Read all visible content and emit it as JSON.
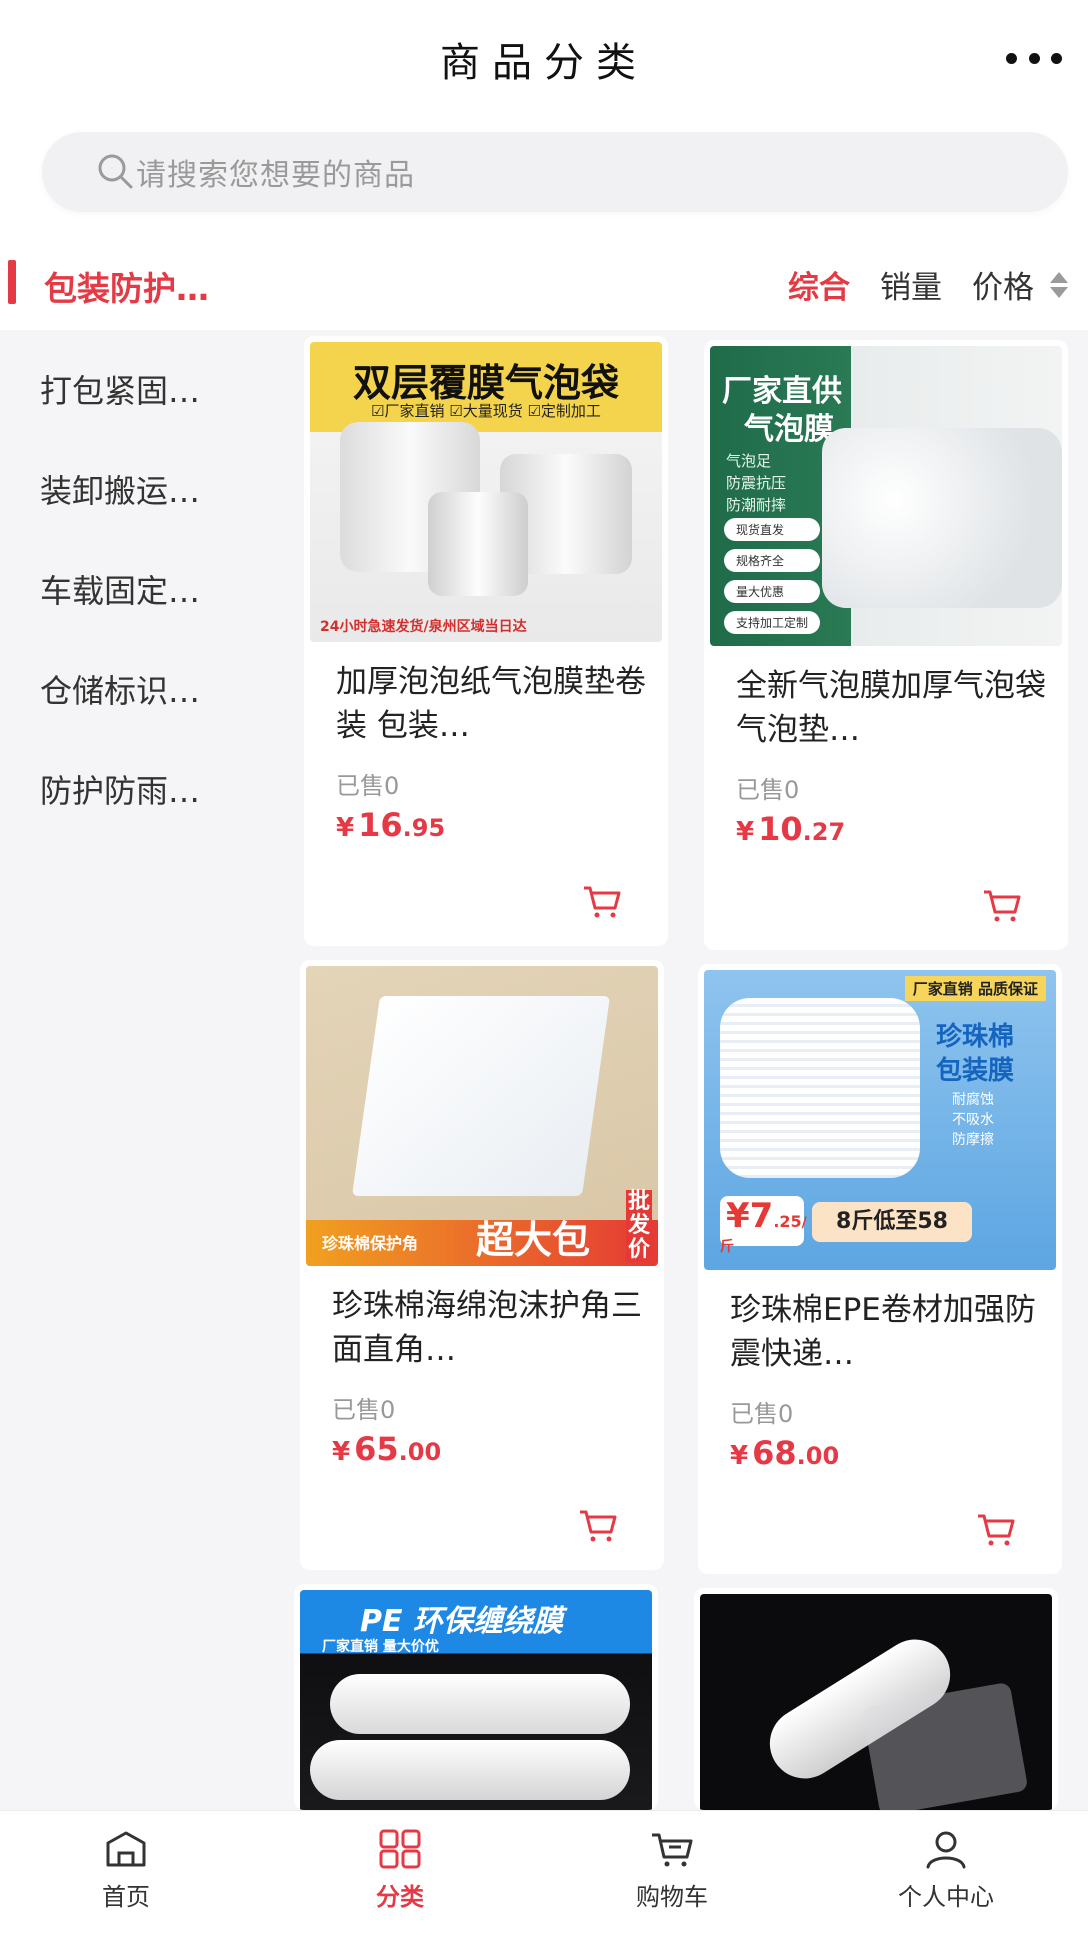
{
  "header": {
    "title": "商品分类",
    "more_icon": "more-dots-icon"
  },
  "search": {
    "placeholder": "请搜索您想要的商品"
  },
  "category": {
    "current": "包装防护…"
  },
  "sort": {
    "comprehensive": "综合",
    "sales": "销量",
    "price": "价格"
  },
  "sidebar": {
    "items": [
      {
        "label": "打包紧固…"
      },
      {
        "label": "装卸搬运…"
      },
      {
        "label": "车载固定…"
      },
      {
        "label": "仓储标识…"
      },
      {
        "label": "防护防雨…"
      }
    ]
  },
  "products": [
    {
      "name": "加厚泡泡纸气泡膜垫卷装 包装…",
      "sold": "已售0",
      "currency": "¥",
      "price_int": "16",
      "price_dec": ".95",
      "img": {
        "headline": "双层覆膜气泡袋",
        "tags": "☑厂家直销 ☑大量现货 ☑定制加工",
        "footer": "24小时急速发货/泉州区域当日达"
      }
    },
    {
      "name": "全新气泡膜加厚气泡袋气泡垫…",
      "sold": "已售0",
      "currency": "¥",
      "price_int": "10",
      "price_dec": ".27",
      "img": {
        "headline": "厂家直供",
        "headline2": "气泡膜",
        "sub": [
          "气泡足",
          "防震抗压",
          "防潮耐摔"
        ],
        "pills": [
          "现货直发",
          "规格齐全",
          "量大优惠",
          "支持加工定制"
        ]
      }
    },
    {
      "name": "珍珠棉海绵泡沫护角三面直角…",
      "sold": "已售0",
      "currency": "¥",
      "price_int": "65",
      "price_dec": ".00",
      "img": {
        "tag": "珍珠棉保护角",
        "banner": "超大包",
        "side": "批发价"
      }
    },
    {
      "name": "珍珠棉EPE卷材加强防震快递…",
      "sold": "已售0",
      "currency": "¥",
      "price_int": "68",
      "price_dec": ".00",
      "img": {
        "top": "厂家直销 品质保证",
        "headline": "珍珠棉",
        "headline2": "包装膜",
        "features": [
          "耐腐蚀",
          "不吸水",
          "防摩擦"
        ],
        "price_badge_int": "¥7",
        "price_badge_dec": ".25",
        "price_badge_unit": "/斤",
        "promo": "8斤低至58"
      }
    },
    {
      "img": {
        "headline": "PE 环保缠绕膜",
        "tags": "厂家直销 量大价优"
      }
    },
    {
      "img": {}
    }
  ],
  "tabbar": {
    "home": "首页",
    "category": "分类",
    "cart": "购物车",
    "profile": "个人中心"
  },
  "colors": {
    "accent": "#e53945",
    "background": "#f5f5f7"
  }
}
